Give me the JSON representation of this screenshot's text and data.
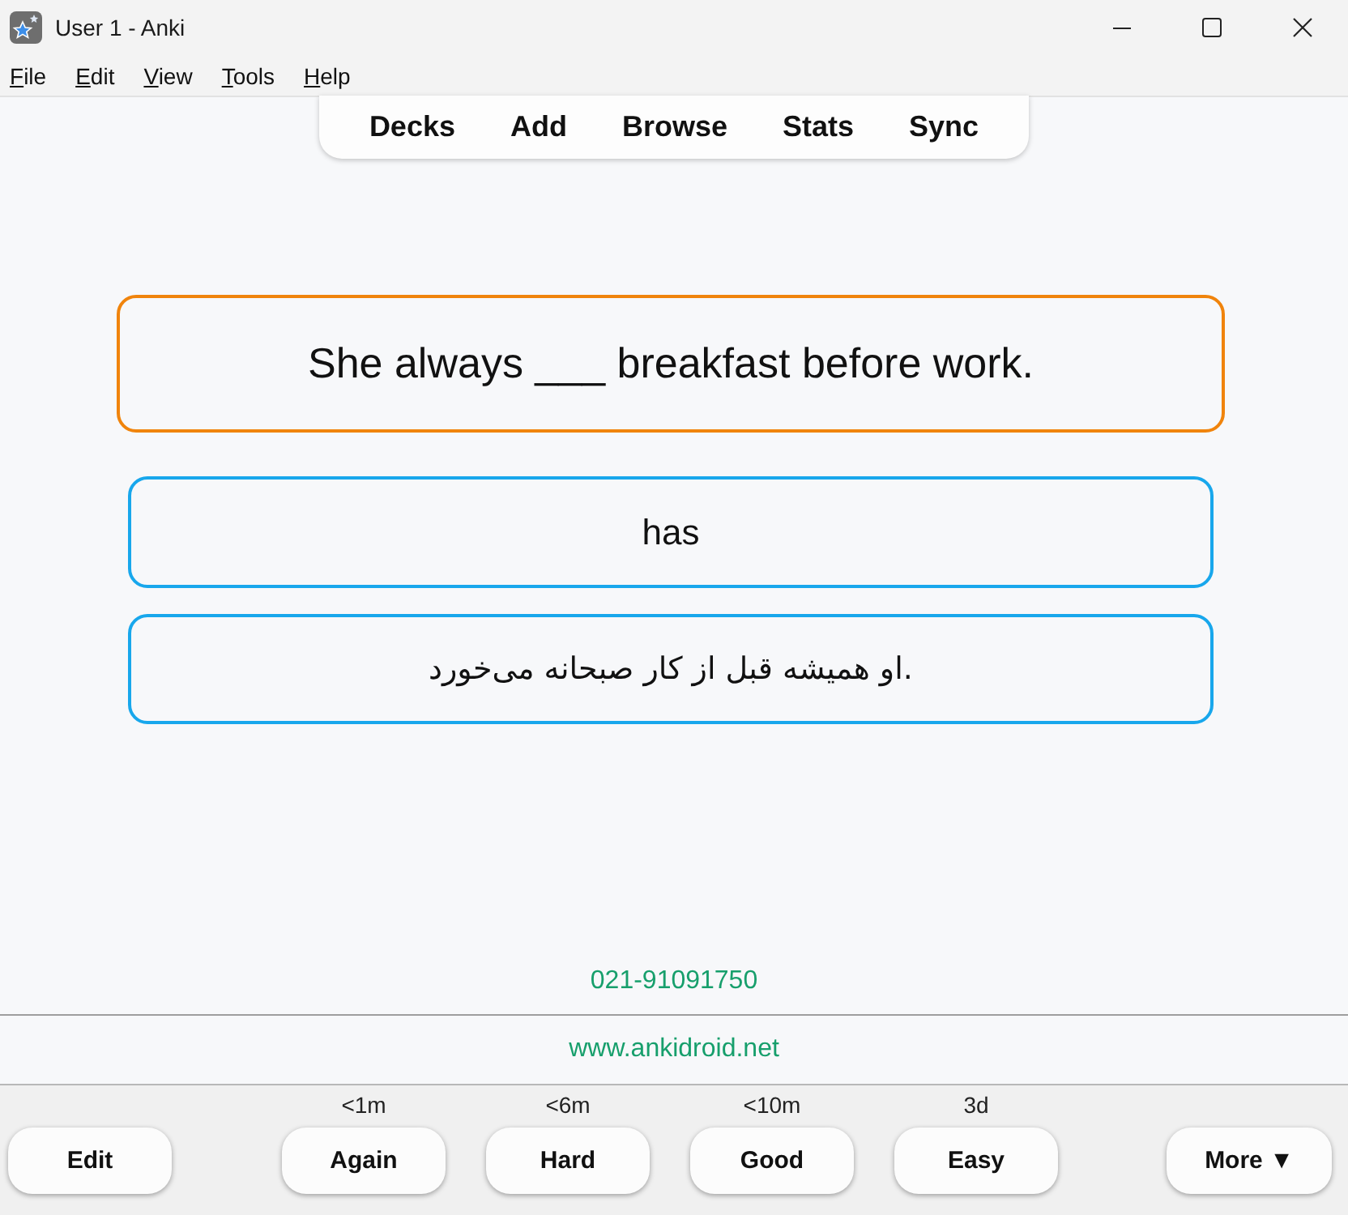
{
  "window": {
    "title": "User 1 - Anki"
  },
  "menu": [
    "File",
    "Edit",
    "View",
    "Tools",
    "Help"
  ],
  "toolbar": [
    "Decks",
    "Add",
    "Browse",
    "Stats",
    "Sync"
  ],
  "cards": [
    {
      "kind": "question",
      "text": "She always ___ breakfast before work."
    },
    {
      "kind": "answer",
      "text": "has"
    },
    {
      "kind": "translation",
      "text": "او همیشه قبل از کار صبحانه می‌خورد."
    }
  ],
  "footer": {
    "phone": "021-91091750",
    "website": "www.ankidroid.net"
  },
  "bottom_bar": {
    "edit": "Edit",
    "answers": [
      {
        "label": "Again",
        "interval": "<1m"
      },
      {
        "label": "Hard",
        "interval": "<6m"
      },
      {
        "label": "Good",
        "interval": "<10m"
      },
      {
        "label": "Easy",
        "interval": "3d"
      }
    ],
    "more": "More ▼"
  }
}
